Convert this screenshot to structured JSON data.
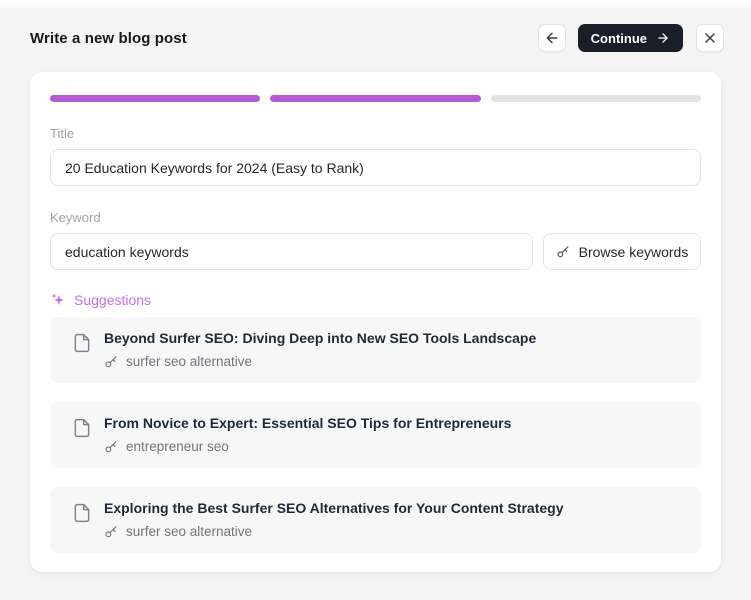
{
  "header": {
    "title": "Write a new blog post",
    "continue_label": "Continue"
  },
  "progress": {
    "total_steps": 3,
    "completed_steps": 2,
    "fill_color": "#b45ad6",
    "track_color": "#e4e4e7"
  },
  "form": {
    "title": {
      "label": "Title",
      "value": "20 Education Keywords for 2024 (Easy to Rank)"
    },
    "keyword": {
      "label": "Keyword",
      "value": "education keywords"
    },
    "browse_keywords_label": "Browse keywords"
  },
  "suggestions": {
    "heading": "Suggestions",
    "accent_color": "#c76fe6",
    "items": [
      {
        "title": "Beyond Surfer SEO: Diving Deep into New SEO Tools Landscape",
        "keyword": "surfer seo alternative"
      },
      {
        "title": "From Novice to Expert: Essential SEO Tips for Entrepreneurs",
        "keyword": "entrepreneur seo"
      },
      {
        "title": "Exploring the Best Surfer SEO Alternatives for Your Content Strategy",
        "keyword": "surfer seo alternative"
      }
    ]
  },
  "icons": {
    "back": "arrow-left-icon",
    "continue": "arrow-right-icon",
    "close": "x-icon",
    "suggestions": "sparkles-icon",
    "browse_keywords": "key-icon",
    "suggestion_file": "file-icon",
    "suggestion_keyword": "key-icon"
  },
  "colors": {
    "page_bg": "#f4f4f5",
    "panel_bg": "#ffffff",
    "card_bg": "#f7f7f8",
    "border": "#e4e4e7",
    "continue_button_bg": "#1a1e29",
    "text_primary": "#1f2937",
    "text_muted": "#a1a1aa",
    "text_secondary": "#74747c"
  }
}
